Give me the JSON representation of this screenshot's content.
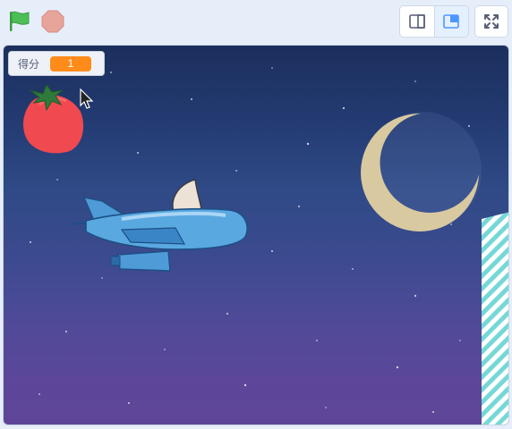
{
  "toolbar": {
    "green_flag_icon": "green-flag-icon",
    "stop_icon": "stop-sign-icon",
    "small_stage_icon": "small-stage-icon",
    "normal_stage_icon": "normal-stage-icon",
    "fullscreen_icon": "fullscreen-icon",
    "active_mode": "normal"
  },
  "stage": {
    "score_monitor": {
      "label": "得分",
      "value": "1"
    },
    "sprites": [
      "strawberry",
      "airplane",
      "moon",
      "striped-building"
    ]
  },
  "colors": {
    "flag_green": "#4cbf56",
    "stop_red": "#e6a49a",
    "monitor_orange": "#ff8c1a",
    "moon": "#d9c9a0",
    "plane_blue": "#5aa8e0",
    "stage_top": "#1c2f5d",
    "stage_bottom": "#5f4597"
  }
}
